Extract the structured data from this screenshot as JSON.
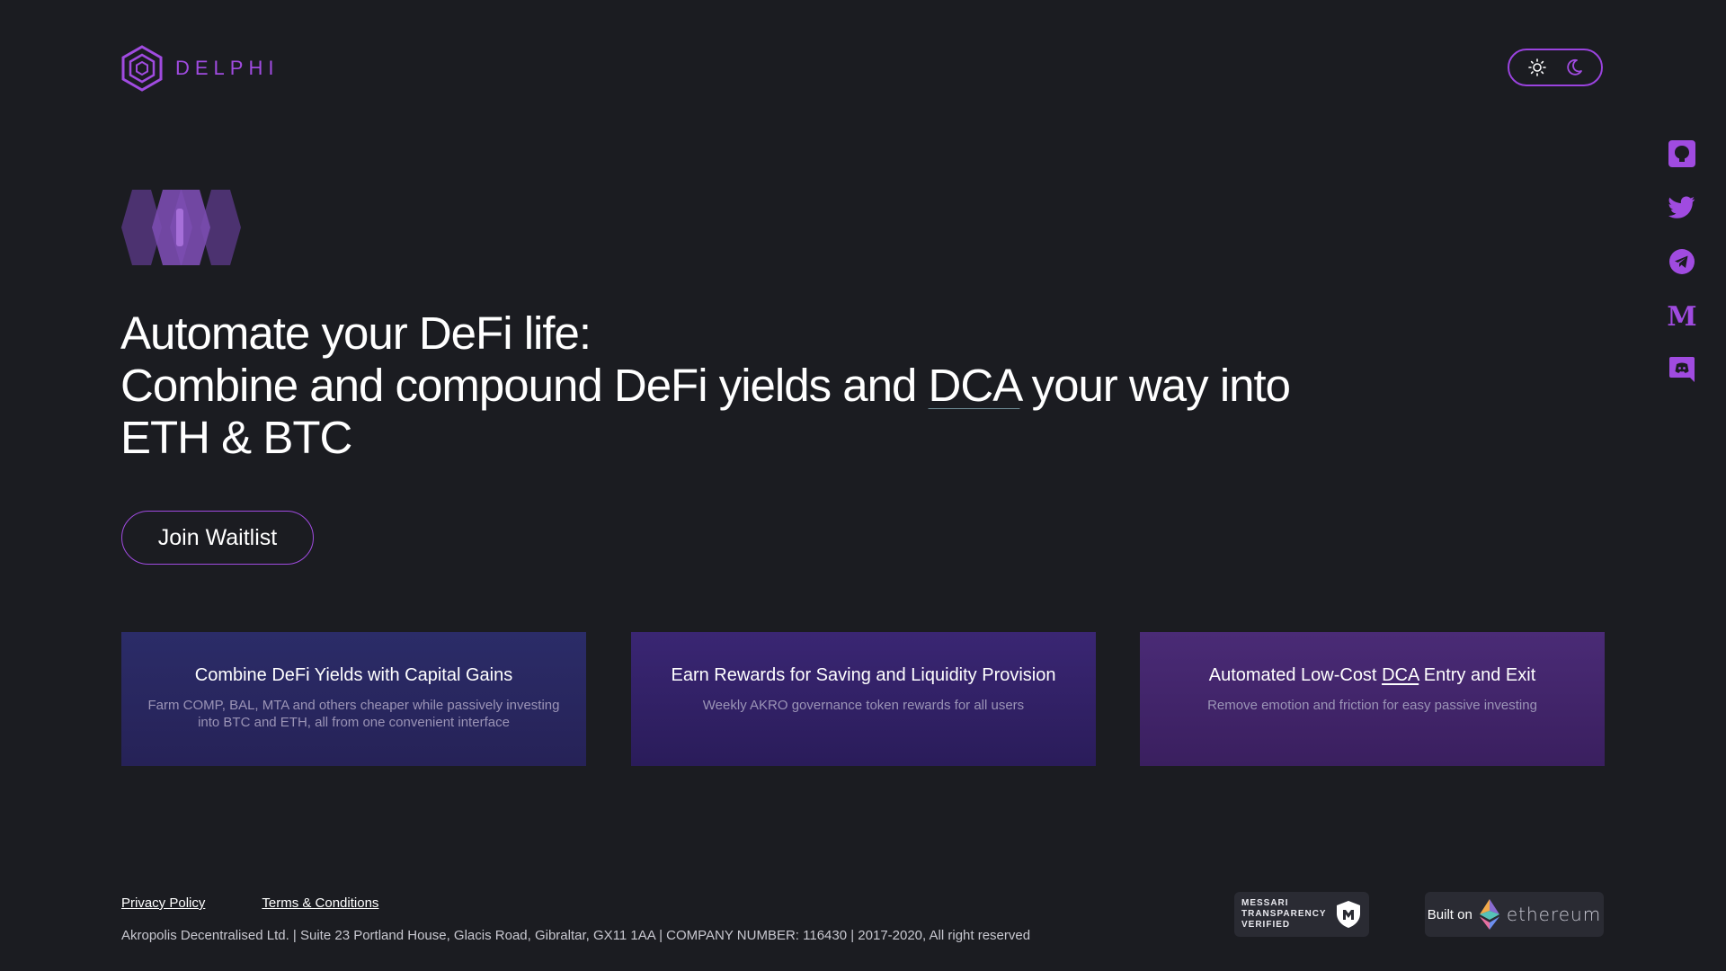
{
  "header": {
    "brand": "DELPHI",
    "theme_toggle": {
      "light_icon": "sun-icon",
      "dark_icon": "moon-icon"
    }
  },
  "social": [
    "github-icon",
    "twitter-icon",
    "telegram-icon",
    "medium-icon",
    "discord-icon"
  ],
  "hero": {
    "line1": "Automate your DeFi life:",
    "line2_before": "Combine and compound DeFi yields and ",
    "line2_dca": "DCA",
    "line2_after": " your way into",
    "line3": "ETH & BTC",
    "cta": "Join Waitlist"
  },
  "features": [
    {
      "title": "Combine DeFi Yields with Capital Gains",
      "desc": "Farm COMP, BAL, MTA and others cheaper while passively investing into BTC and ETH, all from one convenient interface"
    },
    {
      "title": "Earn Rewards for Saving and Liquidity Provision",
      "desc": "Weekly AKRO governance token rewards for all users"
    },
    {
      "title_before": "Automated Low-Cost ",
      "title_dca": "DCA",
      "title_after": " Entry and Exit",
      "desc": "Remove emotion and friction for easy passive investing"
    }
  ],
  "footer": {
    "privacy": "Privacy Policy",
    "terms": "Terms & Conditions",
    "copyright": "Akropolis Decentralised Ltd. | Suite 23 Portland House, Glacis Road, Gibraltar, GX11 1AA | COMPANY NUMBER: 116430 | 2017-2020, All right reserved",
    "messari_line1": "MESSARI",
    "messari_line2": "TRANSPARENCY",
    "messari_line3": "VERIFIED",
    "built_on": "Built on",
    "ethereum": "ethereum"
  },
  "colors": {
    "background": "#1b1c21",
    "accent": "#a04be0"
  }
}
